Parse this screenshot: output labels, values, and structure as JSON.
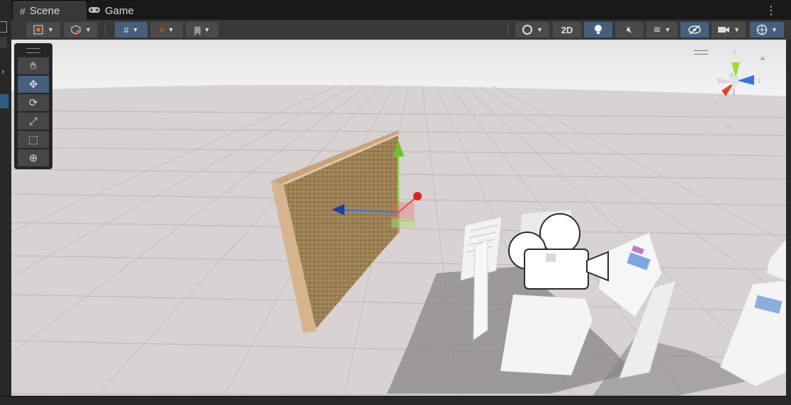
{
  "tabs": [
    {
      "label": "Scene",
      "icon": "grid-hash-icon"
    },
    {
      "label": "Game",
      "icon": "gamepad-icon"
    }
  ],
  "toolbar": {
    "mode_2d_label": "2D",
    "accent_active": "#46607c"
  },
  "tools": [
    {
      "name": "hand-tool",
      "icon": "hand-icon"
    },
    {
      "name": "move-tool",
      "icon": "move-arrows-icon",
      "active": true
    },
    {
      "name": "rotate-tool",
      "icon": "rotate-icon"
    },
    {
      "name": "scale-tool",
      "icon": "scale-icon"
    },
    {
      "name": "rect-tool",
      "icon": "rect-transform-icon"
    },
    {
      "name": "transform-tool",
      "icon": "transform-icon"
    }
  ],
  "orientation_gizmo": {
    "y_label": "y",
    "z_label": "z",
    "x_label": "x",
    "colors": {
      "x": "#e8412f",
      "y": "#9bde3b",
      "z": "#3a72e8"
    }
  },
  "scene": {
    "floor_color": "#d8d2d2",
    "sky_color": "#e9e9e9",
    "board_color": "#9e8356",
    "frame_color": "#c9a37c"
  }
}
